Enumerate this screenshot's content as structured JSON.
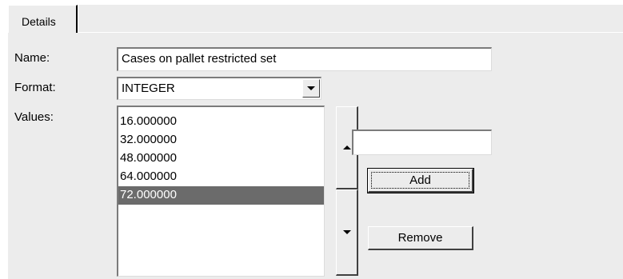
{
  "tabs": [
    {
      "label": "Details"
    }
  ],
  "form": {
    "name_label": "Name:",
    "name_value": "Cases on pallet restricted set",
    "format_label": "Format:",
    "format_value": "INTEGER",
    "values_label": "Values:",
    "values": [
      "16.000000",
      "32.000000",
      "48.000000",
      "64.000000",
      "72.000000"
    ],
    "selected_value": "72.000000",
    "new_value": ""
  },
  "buttons": {
    "add": "Add",
    "remove": "Remove"
  },
  "icons": {
    "scroll_up": "triangle-up-icon",
    "scroll_down": "triangle-down-icon",
    "dropdown": "chevron-down-icon"
  },
  "colors": {
    "panel": "#ececec",
    "selection": "#6b6b6b"
  }
}
